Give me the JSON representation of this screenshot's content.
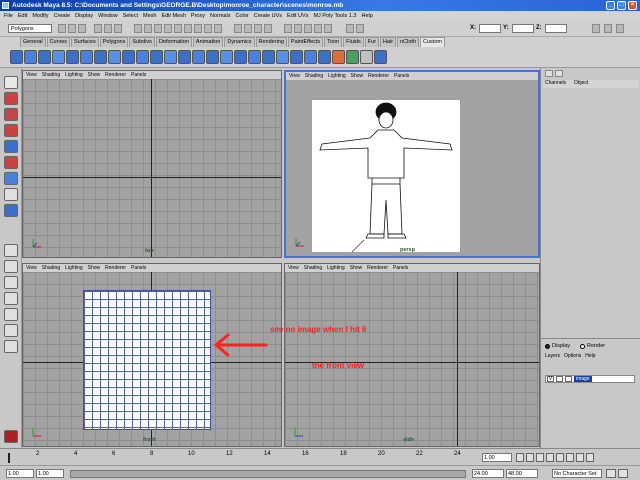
{
  "window": {
    "title": "Autodesk Maya 8.5: C:\\Documents and Settings\\GEORGE.B\\Desktop\\monroe_character\\scenes\\monroe.mb",
    "controls": [
      "_",
      "□",
      "×"
    ]
  },
  "menus": [
    "File",
    "Edit",
    "Modify",
    "Create",
    "Display",
    "Window",
    "Select",
    "Mesh",
    "Edit Mesh",
    "Proxy",
    "Normals",
    "Color",
    "Create UVs",
    "Edit UVs",
    "MJ Poly Tools 1.3",
    "Help"
  ],
  "status": {
    "mode": "Polygons",
    "x": "X:",
    "y": "Y:",
    "z": "Z:"
  },
  "shelf_tabs": [
    "General",
    "Curves",
    "Surfaces",
    "Polygons",
    "Subdivs",
    "Deformation",
    "Animation",
    "Dynamics",
    "Rendering",
    "PaintEffects",
    "Toon",
    "Fluids",
    "Fur",
    "Hair",
    "nCloth",
    "Custom"
  ],
  "shelf_active": "Custom",
  "panel_menu": [
    "View",
    "Shading",
    "Lighting",
    "Show",
    "Renderer",
    "Panels"
  ],
  "viewports": {
    "top": {
      "label": "top"
    },
    "persp": {
      "label": "persp"
    },
    "front": {
      "label": "front"
    },
    "side": {
      "label": "side"
    }
  },
  "channel_box": {
    "tabs": [
      "Channels",
      "Object"
    ]
  },
  "layer_editor": {
    "display_label": "Display",
    "render_label": "Render",
    "menu": [
      "Layers",
      "Options",
      "Help"
    ],
    "layer_visibility": "V",
    "layer_name": "image"
  },
  "timeline": {
    "ticks": [
      "2",
      "4",
      "6",
      "8",
      "10",
      "12",
      "14",
      "16",
      "18",
      "20",
      "22",
      "24"
    ],
    "current_frame": "1.00",
    "start": "1.00",
    "range_start": "1.00",
    "range_end": "24.00",
    "end": "24.00",
    "anim_end": "48.00",
    "character_set": "No Character Set"
  },
  "annotations": {
    "arrow_note": "see no image when I hit 6",
    "front_note": "the front view"
  },
  "colors": {
    "annotation": "#ff2020",
    "active_border": "#4a6fd8",
    "title_bar": "#0a3ea8"
  }
}
